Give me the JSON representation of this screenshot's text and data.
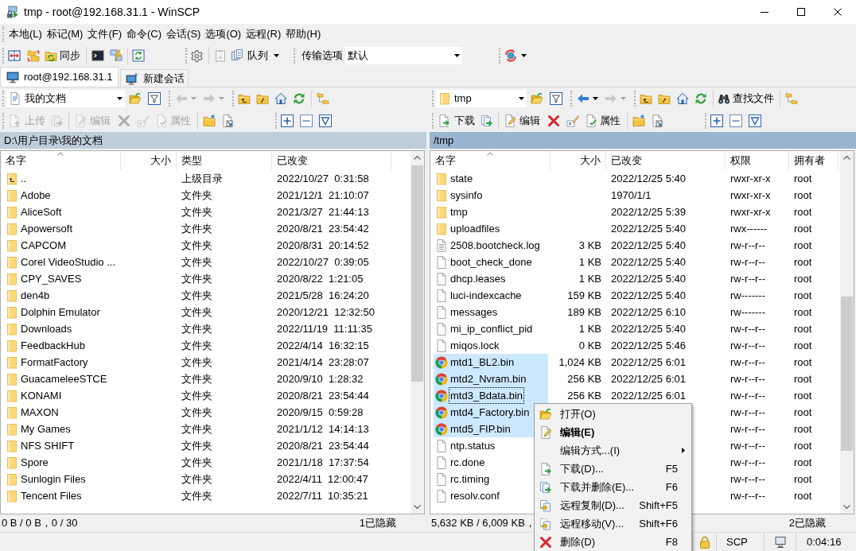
{
  "window": {
    "title": "tmp - root@192.168.31.1 - WinSCP"
  },
  "menu_bar": [
    "本地(L)",
    "标记(M)",
    "文件(F)",
    "命令(C)",
    "会话(S)",
    "选项(O)",
    "远程(R)",
    "帮助(H)"
  ],
  "toolbar": {
    "sync_label": "同步",
    "queue_label": "队列",
    "transfer_options_label": "传输选项",
    "transfer_preset": "默认"
  },
  "session_tabs": [
    {
      "kind": "session",
      "label": "root@192.168.31.1",
      "selected": true
    },
    {
      "kind": "new",
      "label": "新建会话",
      "selected": false
    }
  ],
  "panels": [
    {
      "location": {
        "kind": "documents",
        "value": "我的文档"
      },
      "nav": {
        "back_disabled": true,
        "forward_disabled": true
      },
      "actions": {
        "disabled": true,
        "transfer": {
          "kind": "upload",
          "label": "上传"
        },
        "edit_label": "编辑",
        "properties_label": "属性"
      },
      "path_bar": {
        "path": "D:\\用户目录\\我的文档",
        "active": false
      },
      "columns": [
        {
          "kind": "name",
          "label": "名字",
          "sorted": true
        },
        {
          "kind": "size",
          "label": "大小",
          "sorted": false
        },
        {
          "kind": "type",
          "label": "类型",
          "sorted": false
        },
        {
          "kind": "modified",
          "label": "已改变",
          "sorted": false
        }
      ],
      "rows": [
        {
          "kind": "parent",
          "name": "..",
          "type": "上级目录",
          "modified": "2022/10/27  0:31:58",
          "selected": false
        },
        {
          "kind": "folder",
          "name": "Adobe",
          "type": "文件夹",
          "modified": "2021/12/1  21:10:07",
          "selected": false
        },
        {
          "kind": "folder",
          "name": "AliceSoft",
          "type": "文件夹",
          "modified": "2021/3/27  21:44:13",
          "selected": false
        },
        {
          "kind": "folder",
          "name": "Apowersoft",
          "type": "文件夹",
          "modified": "2020/8/21  23:54:42",
          "selected": false
        },
        {
          "kind": "folder",
          "name": "CAPCOM",
          "type": "文件夹",
          "modified": "2020/8/31  20:14:52",
          "selected": false
        },
        {
          "kind": "folder",
          "name": "Corel VideoStudio ...",
          "type": "文件夹",
          "modified": "2022/10/27  0:39:05",
          "selected": false
        },
        {
          "kind": "folder",
          "name": "CPY_SAVES",
          "type": "文件夹",
          "modified": "2020/8/22  1:21:05",
          "selected": false
        },
        {
          "kind": "folder",
          "name": "den4b",
          "type": "文件夹",
          "modified": "2021/5/28  16:24:20",
          "selected": false
        },
        {
          "kind": "folder",
          "name": "Dolphin Emulator",
          "type": "文件夹",
          "modified": "2020/12/21  12:32:50",
          "selected": false
        },
        {
          "kind": "folder",
          "name": "Downloads",
          "type": "文件夹",
          "modified": "2022/11/19  11:11:35",
          "selected": false
        },
        {
          "kind": "folder",
          "name": "FeedbackHub",
          "type": "文件夹",
          "modified": "2022/4/14  16:32:15",
          "selected": false
        },
        {
          "kind": "folder",
          "name": "FormatFactory",
          "type": "文件夹",
          "modified": "2021/4/14  23:28:07",
          "selected": false
        },
        {
          "kind": "folder",
          "name": "GuacameleeSTCE",
          "type": "文件夹",
          "modified": "2020/9/10  1:28:32",
          "selected": false
        },
        {
          "kind": "folder",
          "name": "KONAMI",
          "type": "文件夹",
          "modified": "2020/8/21  23:54:44",
          "selected": false
        },
        {
          "kind": "folder",
          "name": "MAXON",
          "type": "文件夹",
          "modified": "2020/9/15  0:59:28",
          "selected": false
        },
        {
          "kind": "folder",
          "name": "My Games",
          "type": "文件夹",
          "modified": "2021/1/12  14:14:13",
          "selected": false
        },
        {
          "kind": "folder",
          "name": "NFS SHIFT",
          "type": "文件夹",
          "modified": "2020/8/21  23:54:44",
          "selected": false
        },
        {
          "kind": "folder",
          "name": "Spore",
          "type": "文件夹",
          "modified": "2021/1/18  17:37:54",
          "selected": false
        },
        {
          "kind": "folder",
          "name": "Sunlogin Files",
          "type": "文件夹",
          "modified": "2022/4/11  12:00:47",
          "selected": false
        },
        {
          "kind": "folder",
          "name": "Tencent Files",
          "type": "文件夹",
          "modified": "2022/7/11  10:35:21",
          "selected": false
        }
      ],
      "status": {
        "summary": "0 B / 0 B，0 / 30",
        "hidden": "1已隐藏"
      }
    },
    {
      "location": {
        "kind": "folder",
        "value": "tmp"
      },
      "nav": {
        "back_disabled": false,
        "forward_disabled": true
      },
      "find_label": "查找文件",
      "actions": {
        "disabled": false,
        "transfer": {
          "kind": "download",
          "label": "下载"
        },
        "edit_label": "编辑",
        "properties_label": "属性"
      },
      "path_bar": {
        "path": "/tmp",
        "active": true
      },
      "columns": [
        {
          "kind": "name",
          "label": "名字",
          "sorted": true
        },
        {
          "kind": "size",
          "label": "大小",
          "sorted": false
        },
        {
          "kind": "modified",
          "label": "已改变",
          "sorted": false
        },
        {
          "kind": "permissions",
          "label": "权限",
          "sorted": false
        },
        {
          "kind": "owner",
          "label": "拥有者",
          "sorted": false
        }
      ],
      "rows": [
        {
          "kind": "folder",
          "name": "state",
          "modified": "2022/12/25 5:40",
          "permissions": "rwxr-xr-x",
          "owner": "root",
          "selected": false,
          "focused": false
        },
        {
          "kind": "folder",
          "name": "sysinfo",
          "modified": "1970/1/1",
          "permissions": "rwxr-xr-x",
          "owner": "root",
          "selected": false,
          "focused": false
        },
        {
          "kind": "folder",
          "name": "tmp",
          "modified": "2022/12/25 5:39",
          "permissions": "rwxr-xr-x",
          "owner": "root",
          "selected": false,
          "focused": false
        },
        {
          "kind": "folder",
          "name": "uploadfiles",
          "modified": "2022/12/25 5:40",
          "permissions": "rwx------",
          "owner": "root",
          "selected": false,
          "focused": false
        },
        {
          "kind": "text",
          "name": "2508.bootcheck.log",
          "size": "3 KB",
          "modified": "2022/12/25 5:40",
          "permissions": "rw-r--r--",
          "owner": "root",
          "selected": false,
          "focused": false
        },
        {
          "kind": "file",
          "name": "boot_check_done",
          "size": "1 KB",
          "modified": "2022/12/25 5:40",
          "permissions": "rw-r--r--",
          "owner": "root",
          "selected": false,
          "focused": false
        },
        {
          "kind": "file",
          "name": "dhcp.leases",
          "size": "1 KB",
          "modified": "2022/12/25 5:40",
          "permissions": "rw-r--r--",
          "owner": "root",
          "selected": false,
          "focused": false
        },
        {
          "kind": "file",
          "name": "luci-indexcache",
          "size": "159 KB",
          "modified": "2022/12/25 5:40",
          "permissions": "rw-------",
          "owner": "root",
          "selected": false,
          "focused": false
        },
        {
          "kind": "file",
          "name": "messages",
          "size": "189 KB",
          "modified": "2022/12/25 6:10",
          "permissions": "rw-------",
          "owner": "root",
          "selected": false,
          "focused": false
        },
        {
          "kind": "file",
          "name": "mi_ip_conflict_pid",
          "size": "1 KB",
          "modified": "2022/12/25 5:40",
          "permissions": "rw-r--r--",
          "owner": "root",
          "selected": false,
          "focused": false
        },
        {
          "kind": "file",
          "name": "miqos.lock",
          "size": "0 KB",
          "modified": "2022/12/25 5:46",
          "permissions": "rw-r--r--",
          "owner": "root",
          "selected": false,
          "focused": false
        },
        {
          "kind": "bin",
          "name": "mtd1_BL2.bin",
          "size": "1,024 KB",
          "modified": "2022/12/25 6:01",
          "permissions": "rw-r--r--",
          "owner": "root",
          "selected": true,
          "focused": false
        },
        {
          "kind": "bin",
          "name": "mtd2_Nvram.bin",
          "size": "256 KB",
          "modified": "2022/12/25 6:01",
          "permissions": "rw-r--r--",
          "owner": "root",
          "selected": true,
          "focused": false
        },
        {
          "kind": "bin",
          "name": "mtd3_Bdata.bin",
          "size": "256 KB",
          "modified": "2022/12/25 6:01",
          "permissions": "rw-r--r--",
          "owner": "root",
          "selected": true,
          "focused": true
        },
        {
          "kind": "bin",
          "name": "mtd4_Factory.bin",
          "permissions": "rw-r--r--",
          "owner": "root",
          "selected": true,
          "focused": false
        },
        {
          "kind": "bin",
          "name": "mtd5_FIP.bin",
          "permissions": "rw-r--r--",
          "owner": "root",
          "selected": true,
          "focused": false
        },
        {
          "kind": "file",
          "name": "ntp.status",
          "permissions": "rw-r--r--",
          "owner": "root",
          "selected": false,
          "focused": false
        },
        {
          "kind": "file",
          "name": "rc.done",
          "permissions": "rw-r--r--",
          "owner": "root",
          "selected": false,
          "focused": false
        },
        {
          "kind": "file",
          "name": "rc.timing",
          "permissions": "rw-r--r--",
          "owner": "root",
          "selected": false,
          "focused": false
        },
        {
          "kind": "file",
          "name": "resolv.conf",
          "permissions": "rw-r--r--",
          "owner": "root",
          "selected": false,
          "focused": false
        }
      ],
      "status": {
        "summary": "5,632 KB / 6,009 KB，",
        "hidden": "2已隐藏"
      }
    }
  ],
  "context_menu": {
    "items": [
      {
        "kind": "open",
        "label": "打开(O)",
        "default": false,
        "submenu": false
      },
      {
        "kind": "edit",
        "label": "编辑(E)",
        "default": true,
        "submenu": false
      },
      {
        "kind": "edit-with",
        "label": "编辑方式...(I)",
        "default": false,
        "submenu": true
      },
      {
        "kind": "download",
        "label": "下载(D)...",
        "shortcut": "F5",
        "default": false,
        "submenu": false
      },
      {
        "kind": "download-delete",
        "label": "下载并删除(E)...",
        "shortcut": "F6",
        "default": false,
        "submenu": false
      },
      {
        "kind": "copy",
        "label": "远程复制(D)...",
        "shortcut": "Shift+F5",
        "default": false,
        "submenu": false
      },
      {
        "kind": "move",
        "label": "远程移动(V)...",
        "shortcut": "Shift+F6",
        "default": false,
        "submenu": false
      },
      {
        "kind": "delete",
        "label": "删除(D)",
        "shortcut": "F8",
        "default": false,
        "submenu": false
      }
    ]
  },
  "session_status": {
    "protocol": "SCP",
    "duration": "0:04:16"
  }
}
